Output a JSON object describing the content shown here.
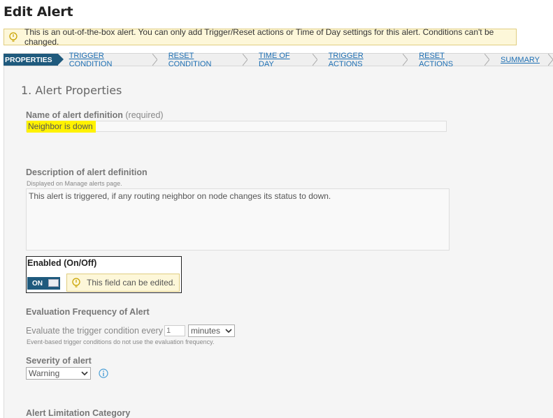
{
  "page": {
    "title": "Edit Alert"
  },
  "notice": {
    "text": "This is an out-of-the-box alert. You can only add Trigger/Reset actions or Time of Day settings for this alert. Conditions can't be changed.",
    "icon": "lightbulb-icon"
  },
  "steps": [
    {
      "label": "PROPERTIES",
      "active": true
    },
    {
      "label": "TRIGGER CONDITION"
    },
    {
      "label": "RESET CONDITION"
    },
    {
      "label": "TIME OF DAY"
    },
    {
      "label": "TRIGGER ACTIONS"
    },
    {
      "label": "RESET ACTIONS"
    },
    {
      "label": "SUMMARY"
    }
  ],
  "section": {
    "title": "1. Alert Properties"
  },
  "name_field": {
    "label": "Name of alert definition",
    "required": "(required)",
    "value": "Neighbor is down",
    "highlight": "#fff200"
  },
  "description": {
    "label": "Description of alert definition",
    "hint": "Displayed on Manage alerts page.",
    "value": "This alert is triggered, if any routing neighbor on node changes its status to down."
  },
  "enabled": {
    "label": "Enabled (On/Off)",
    "state": "ON",
    "tip": "This field can be edited."
  },
  "evaluation": {
    "label": "Evaluation Frequency of Alert",
    "prefix": "Evaluate the trigger condition every",
    "value": "1",
    "unit": "minutes",
    "hint": "Event-based trigger conditions do not use the evaluation frequency."
  },
  "severity": {
    "label": "Severity of alert",
    "value": "Warning",
    "info_icon": "info-icon"
  },
  "limitation": {
    "label": "Alert Limitation Category"
  },
  "colors": {
    "accent": "#1f5a7d",
    "link": "#1d6fb3",
    "notice_bg": "#fdf7d9"
  }
}
